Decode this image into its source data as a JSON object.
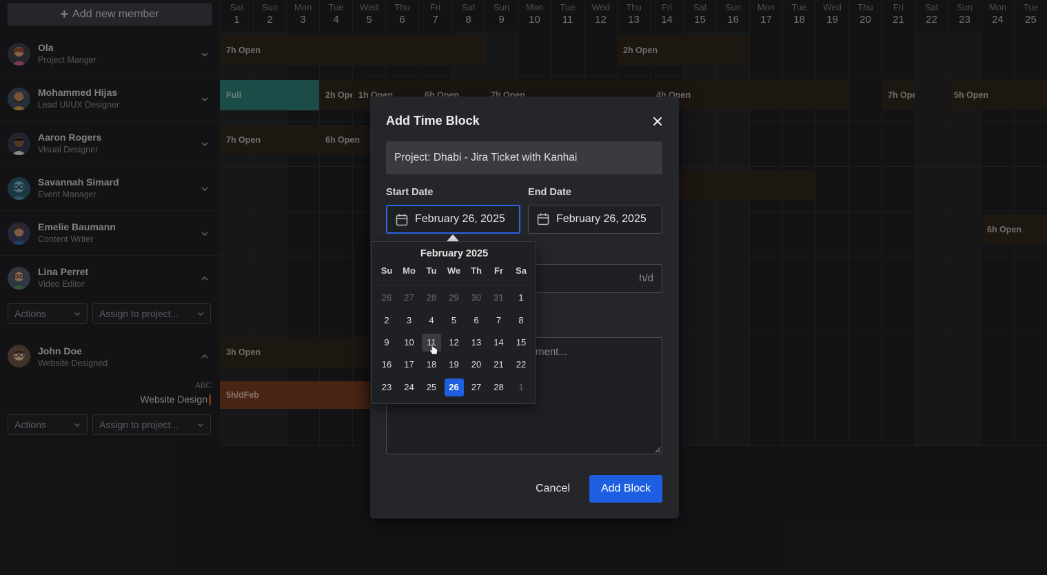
{
  "sidebar": {
    "add_button_label": "Add new member",
    "members": [
      {
        "name": "Ola",
        "role": "Project Manger"
      },
      {
        "name": "Mohammed Hijas",
        "role": "Lead UI/UX Designer"
      },
      {
        "name": "Aaron Rogers",
        "role": "Visual Designer"
      },
      {
        "name": "Savannah Simard",
        "role": "Event Manager"
      },
      {
        "name": "Emelie Baumann",
        "role": "Content Writer"
      },
      {
        "name": "Lina Perret",
        "role": "Video Editor"
      },
      {
        "name": "John Doe",
        "role": "Website Designed"
      }
    ],
    "actions_label": "Actions",
    "assign_placeholder": "Assign to project...",
    "sub_project": {
      "client": "ABC",
      "name": "Website Design"
    }
  },
  "calendar": {
    "days": [
      {
        "dow": "Sat",
        "num": "1"
      },
      {
        "dow": "Sun",
        "num": "2"
      },
      {
        "dow": "Mon",
        "num": "3"
      },
      {
        "dow": "Tue",
        "num": "4"
      },
      {
        "dow": "Wed",
        "num": "5"
      },
      {
        "dow": "Thu",
        "num": "6"
      },
      {
        "dow": "Fri",
        "num": "7"
      },
      {
        "dow": "Sat",
        "num": "8"
      },
      {
        "dow": "Sun",
        "num": "9"
      },
      {
        "dow": "Mon",
        "num": "10"
      },
      {
        "dow": "Tue",
        "num": "11"
      },
      {
        "dow": "Wed",
        "num": "12"
      },
      {
        "dow": "Thu",
        "num": "13"
      },
      {
        "dow": "Fri",
        "num": "14"
      },
      {
        "dow": "Sat",
        "num": "15"
      },
      {
        "dow": "Sun",
        "num": "16"
      },
      {
        "dow": "Mon",
        "num": "17"
      },
      {
        "dow": "Tue",
        "num": "18"
      },
      {
        "dow": "Wed",
        "num": "19"
      },
      {
        "dow": "Thu",
        "num": "20"
      },
      {
        "dow": "Fri",
        "num": "21"
      },
      {
        "dow": "Sat",
        "num": "22"
      },
      {
        "dow": "Sun",
        "num": "23"
      },
      {
        "dow": "Mon",
        "num": "24"
      },
      {
        "dow": "Tue",
        "num": "25"
      }
    ],
    "blocks": {
      "b1": "7h Open",
      "b2": "2h Open",
      "b3": "Full",
      "b4": "2h Ope",
      "b5": "1h Open",
      "b6": "6h Open",
      "b7": "7h Open",
      "b8": "4h Open",
      "b9": "7h Ope",
      "b10": "5h Open",
      "b11": "7h Open",
      "b12": "6h Open",
      "b13": "6h Open",
      "b14": "3h Open",
      "b15": "5h/dFeb"
    }
  },
  "modal": {
    "title": "Add Time Block",
    "project": "Project: Dhabi - Jira Ticket with Kanhai",
    "start_label": "Start Date",
    "end_label": "End Date",
    "start_value": "February 26, 2025",
    "end_value": "February 26, 2025",
    "hours_unit": "h/d",
    "notes_placeholder_visible": "ment...",
    "cancel_label": "Cancel",
    "submit_label": "Add Block"
  },
  "picker": {
    "title": "February 2025",
    "weekdays": [
      "Su",
      "Mo",
      "Tu",
      "We",
      "Th",
      "Fr",
      "Sa"
    ],
    "weeks": [
      [
        "26",
        "27",
        "28",
        "29",
        "30",
        "31",
        "1"
      ],
      [
        "2",
        "3",
        "4",
        "5",
        "6",
        "7",
        "8"
      ],
      [
        "9",
        "10",
        "11",
        "12",
        "13",
        "14",
        "15"
      ],
      [
        "16",
        "17",
        "18",
        "19",
        "20",
        "21",
        "22"
      ],
      [
        "23",
        "24",
        "25",
        "26",
        "27",
        "28",
        "1"
      ]
    ],
    "selected": "26",
    "hovered": "11"
  },
  "colors": {
    "accent": "#1d5fe0",
    "full": "#2a7d72",
    "open": "#2b2218",
    "project": "#7a3a1a"
  }
}
